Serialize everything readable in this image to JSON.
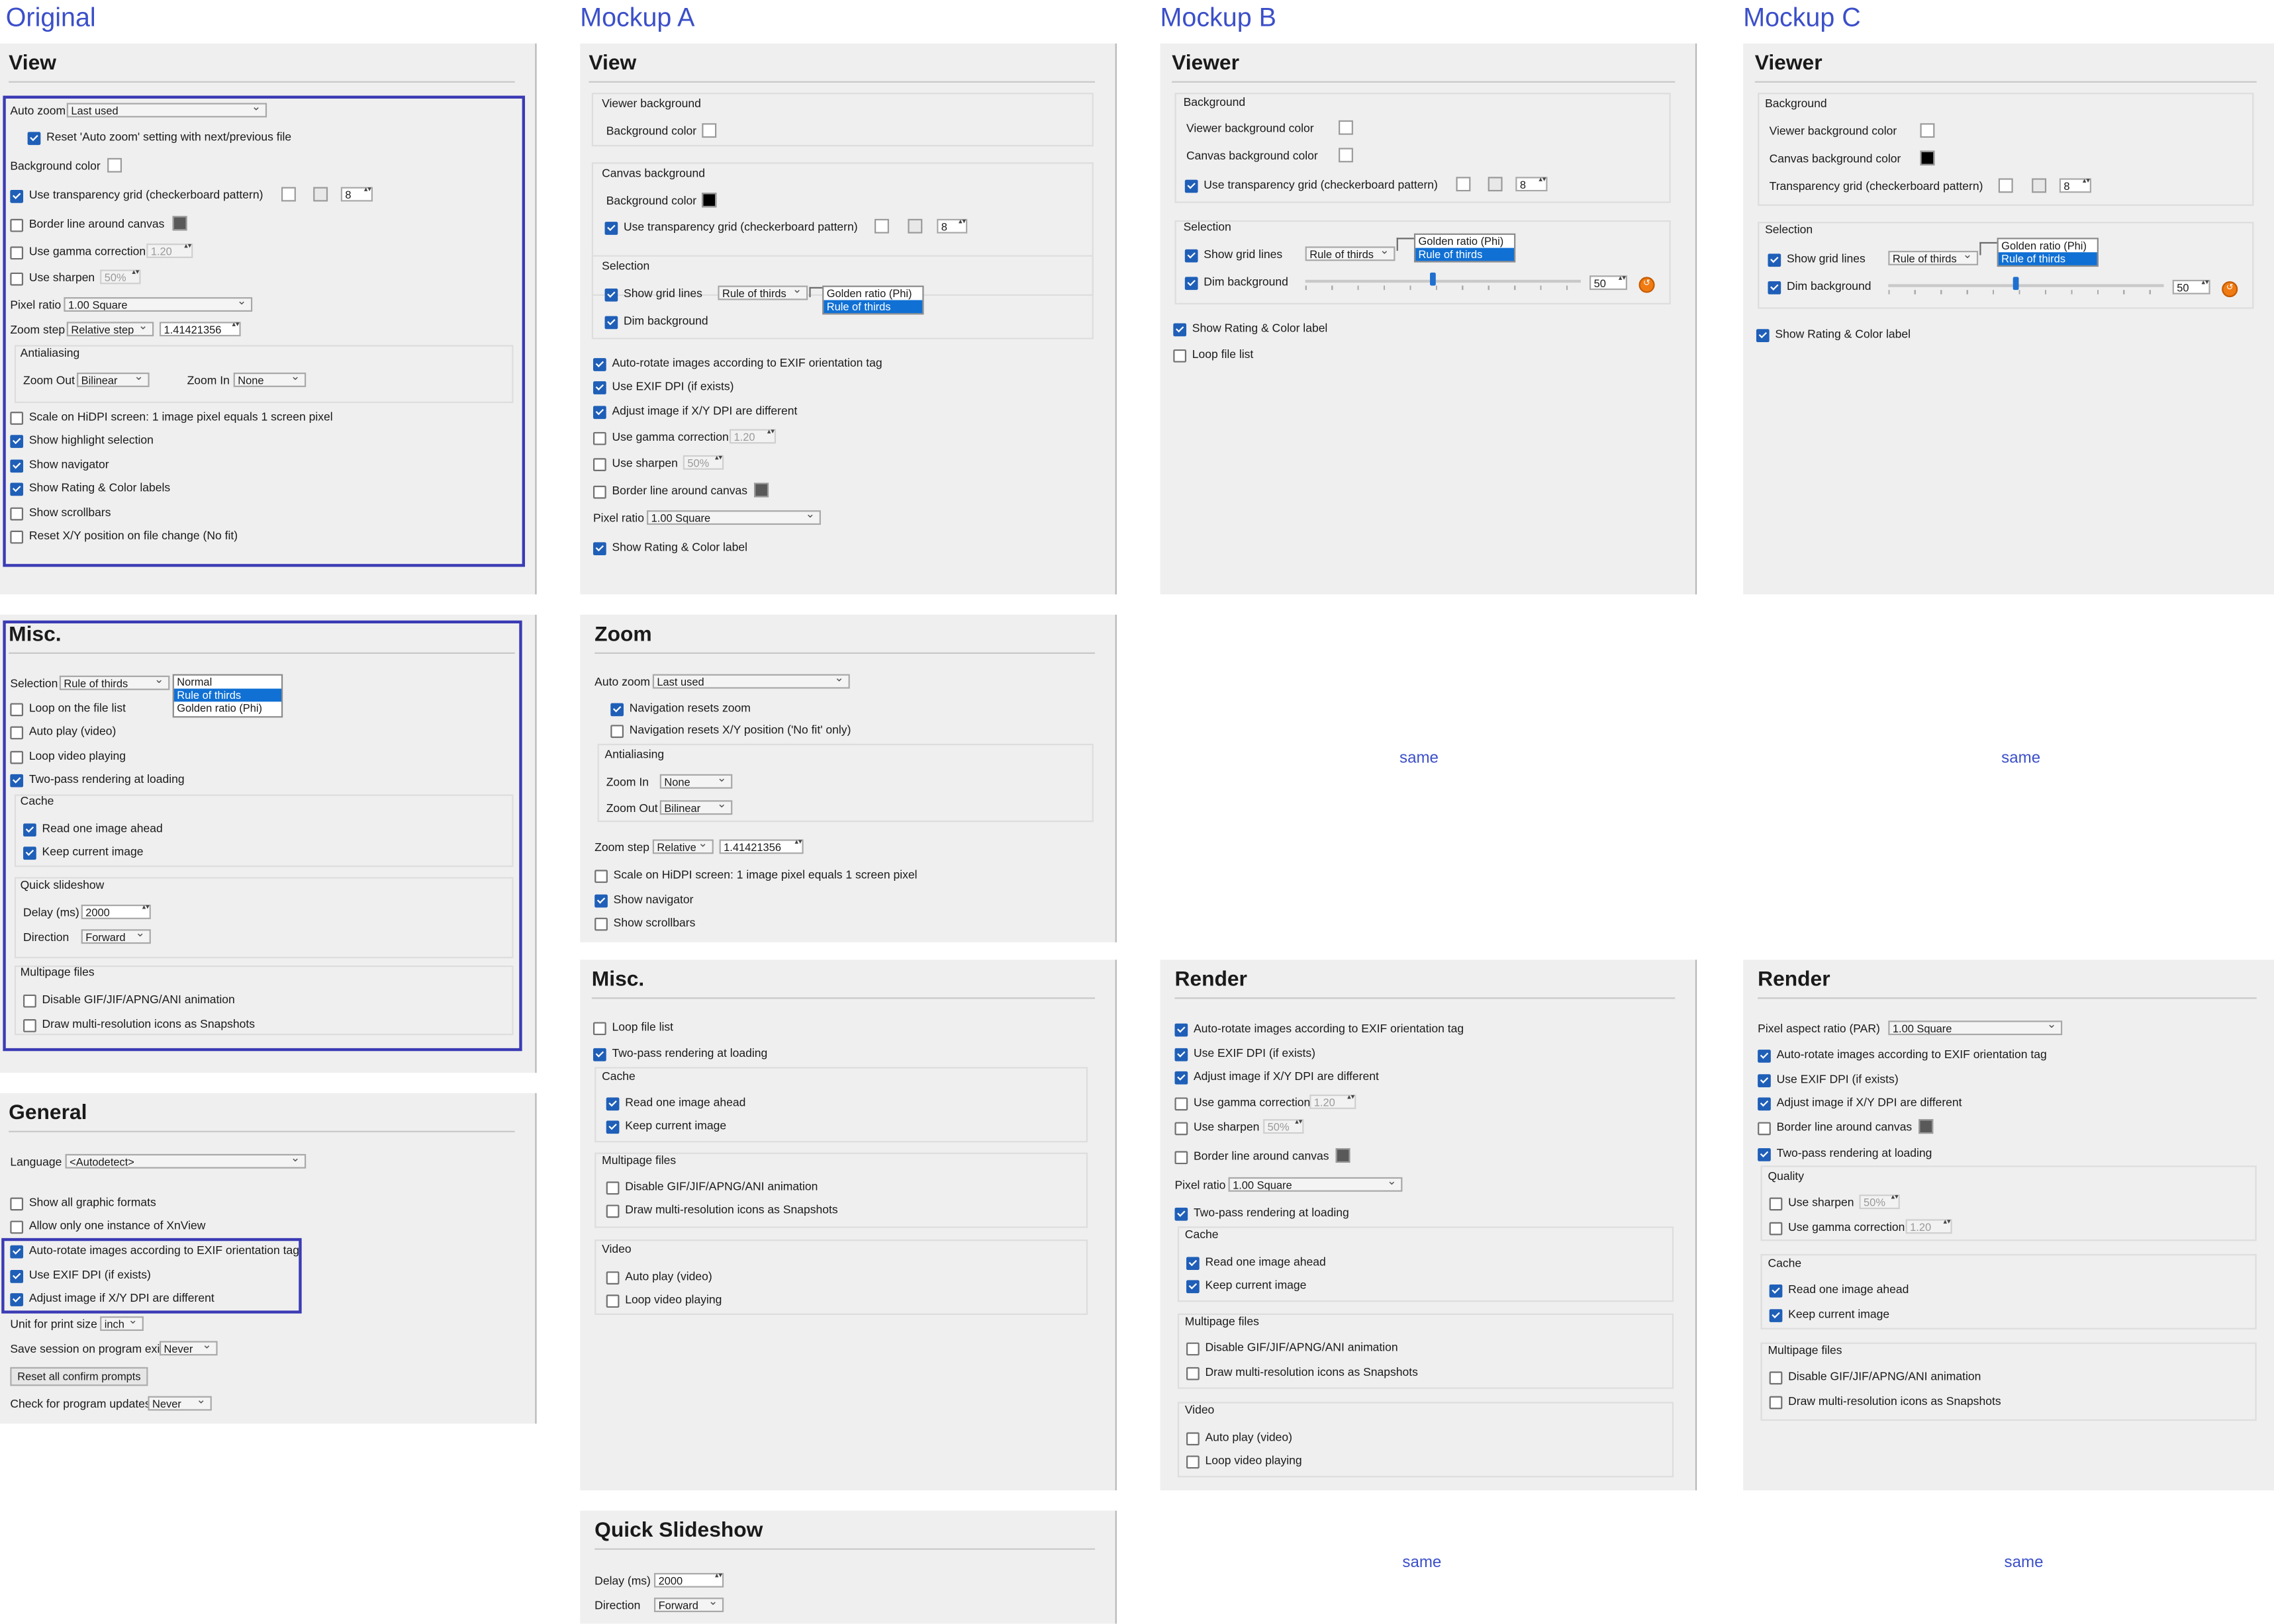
{
  "headers": {
    "original": "Original",
    "a": "Mockup A",
    "b": "Mockup B",
    "c": "Mockup C"
  },
  "same_text": "same",
  "orig_view": {
    "title": "View",
    "auto_zoom_label": "Auto zoom",
    "auto_zoom_value": "Last used",
    "reset_auto_zoom": "Reset 'Auto zoom' setting with next/previous file",
    "bg_color": "Background color",
    "transparency": "Use transparency grid (checkerboard pattern)",
    "grid_size": "8",
    "border_line": "Border line around canvas",
    "gamma": "Use gamma correction",
    "gamma_value": "1.20",
    "sharpen": "Use sharpen",
    "sharpen_value": "50%",
    "pixel_ratio_label": "Pixel ratio",
    "pixel_ratio_value": "1.00  Square",
    "zoom_step_label": "Zoom step",
    "zoom_step_mode": "Relative step",
    "zoom_step_value": "1.41421356",
    "antialiasing": "Antialiasing",
    "zoom_out_label": "Zoom Out",
    "zoom_out_value": "Bilinear",
    "zoom_in_label": "Zoom In",
    "zoom_in_value": "None",
    "hidpi": "Scale on HiDPI screen: 1 image pixel equals 1 screen pixel",
    "highlight": "Show highlight selection",
    "navigator": "Show navigator",
    "rating": "Show Rating & Color labels",
    "scrollbars": "Show scrollbars",
    "reset_xy": "Reset X/Y position on file change (No fit)"
  },
  "orig_misc": {
    "title": "Misc.",
    "selection_label": "Selection",
    "selection_value": "Rule of thirds",
    "selection_options": [
      "Normal",
      "Rule of thirds",
      "Golden ratio (Phi)"
    ],
    "loop": "Loop on the file list",
    "auto_play": "Auto play (video)",
    "loop_video": "Loop video playing",
    "two_pass": "Two-pass rendering at loading",
    "cache": "Cache",
    "read_ahead": "Read one image ahead",
    "keep_current": "Keep current image",
    "quick_slideshow": "Quick slideshow",
    "delay_label": "Delay (ms)",
    "delay_value": "2000",
    "direction_label": "Direction",
    "direction_value": "Forward",
    "multipage": "Multipage files",
    "disable_gif": "Disable GIF/JIF/APNG/ANI animation",
    "draw_multi": "Draw multi-resolution icons as Snapshots"
  },
  "orig_general": {
    "title": "General",
    "language_label": "Language",
    "language_value": "<Autodetect>",
    "show_all_formats": "Show all graphic formats",
    "one_instance": "Allow only one instance of XnView",
    "auto_rotate": "Auto-rotate images according to EXIF orientation tag",
    "exif_dpi": "Use EXIF DPI (if exists)",
    "adjust_dpi": "Adjust image if X/Y DPI are different",
    "unit_label": "Unit for print size",
    "unit_value": "inch",
    "save_session_label": "Save session on program exit",
    "save_session_value": "Never",
    "reset_prompts": "Reset all confirm prompts",
    "check_updates_label": "Check for program updates",
    "check_updates_value": "Never"
  },
  "a_view": {
    "title": "View",
    "viewer_bg": "Viewer background",
    "bg_color": "Background color",
    "canvas_bg": "Canvas background",
    "canvas_bg_color": "Background color",
    "transparency": "Use transparency grid (checkerboard pattern)",
    "grid_size": "8",
    "selection": "Selection",
    "grid_lines": "Show grid lines",
    "grid_value": "Rule of thirds",
    "grid_options": [
      "Golden ratio (Phi)",
      "Rule of thirds"
    ],
    "dim": "Dim background",
    "auto_rotate": "Auto-rotate images according to EXIF orientation tag",
    "exif_dpi": "Use EXIF DPI (if exists)",
    "adjust_dpi": "Adjust image if X/Y DPI are different",
    "gamma": "Use gamma correction",
    "gamma_value": "1.20",
    "sharpen": "Use sharpen",
    "sharpen_value": "50%",
    "border_line": "Border line around canvas",
    "pixel_ratio_label": "Pixel ratio",
    "pixel_ratio_value": "1.00  Square",
    "rating": "Show Rating & Color label"
  },
  "a_zoom": {
    "title": "Zoom",
    "auto_zoom_label": "Auto zoom",
    "auto_zoom_value": "Last used",
    "nav_resets": "Navigation resets zoom",
    "nav_resets_xy": "Navigation resets X/Y position ('No fit' only)",
    "antialiasing": "Antialiasing",
    "zoom_in_label": "Zoom In",
    "zoom_in_value": "None",
    "zoom_out_label": "Zoom Out",
    "zoom_out_value": "Bilinear",
    "zoom_step_label": "Zoom step",
    "zoom_step_mode": "Relative",
    "zoom_step_value": "1.41421356",
    "hidpi": "Scale on HiDPI screen: 1 image pixel equals 1 screen pixel",
    "navigator": "Show navigator",
    "scrollbars": "Show scrollbars"
  },
  "a_misc": {
    "title": "Misc.",
    "loop": "Loop file list",
    "two_pass": "Two-pass rendering at loading",
    "cache": "Cache",
    "read_ahead": "Read one image ahead",
    "keep_current": "Keep current image",
    "multipage": "Multipage files",
    "disable_gif": "Disable GIF/JIF/APNG/ANI animation",
    "draw_multi": "Draw multi-resolution icons as Snapshots",
    "video": "Video",
    "auto_play": "Auto play (video)",
    "loop_video": "Loop video playing"
  },
  "a_slideshow": {
    "title": "Quick Slideshow",
    "delay_label": "Delay (ms)",
    "delay_value": "2000",
    "direction_label": "Direction",
    "direction_value": "Forward"
  },
  "b_viewer": {
    "title": "Viewer",
    "background": "Background",
    "viewer_bg": "Viewer background color",
    "canvas_bg": "Canvas background color",
    "transparency": "Use transparency grid (checkerboard pattern)",
    "grid_size": "8",
    "selection": "Selection",
    "grid_lines": "Show grid lines",
    "grid_value": "Rule of thirds",
    "grid_options": [
      "Golden ratio (Phi)",
      "Rule of thirds"
    ],
    "dim": "Dim background",
    "dim_value": "50",
    "dim_level": 0.45,
    "rating": "Show Rating & Color label",
    "loop": "Loop  file list"
  },
  "b_render": {
    "title": "Render",
    "auto_rotate": "Auto-rotate images according to EXIF orientation tag",
    "exif_dpi": "Use EXIF DPI (if exists)",
    "adjust_dpi": "Adjust image if X/Y DPI are different",
    "gamma": "Use gamma correction",
    "gamma_value": "1.20",
    "sharpen": "Use sharpen",
    "sharpen_value": "50%",
    "border_line": "Border line around canvas",
    "pixel_ratio_label": "Pixel ratio",
    "pixel_ratio_value": "1.00  Square",
    "two_pass": "Two-pass rendering at loading",
    "cache": "Cache",
    "read_ahead": "Read one image ahead",
    "keep_current": "Keep current image",
    "multipage": "Multipage files",
    "disable_gif": "Disable GIF/JIF/APNG/ANI animation",
    "draw_multi": "Draw multi-resolution icons as Snapshots",
    "video": "Video",
    "auto_play": "Auto play (video)",
    "loop_video": "Loop video playing"
  },
  "c_viewer": {
    "title": "Viewer",
    "background": "Background",
    "viewer_bg": "Viewer background color",
    "canvas_bg": "Canvas background color",
    "transparency": "Transparency grid (checkerboard pattern)",
    "grid_size": "8",
    "selection": "Selection",
    "grid_lines": "Show grid lines",
    "grid_value": "Rule of thirds",
    "grid_options": [
      "Golden ratio (Phi)",
      "Rule of thirds"
    ],
    "dim": "Dim background",
    "dim_value": "50",
    "dim_level": 0.45,
    "rating": "Show Rating & Color label"
  },
  "c_render": {
    "title": "Render",
    "par_label": "Pixel aspect ratio (PAR)",
    "par_value": "1.00  Square",
    "auto_rotate": "Auto-rotate images according to EXIF orientation tag",
    "exif_dpi": "Use EXIF DPI (if exists)",
    "adjust_dpi": "Adjust image if X/Y DPI are different",
    "border_line": "Border line around canvas",
    "two_pass": "Two-pass rendering at loading",
    "quality": "Quality",
    "sharpen": "Use sharpen",
    "sharpen_value": "50%",
    "gamma": "Use gamma correction",
    "gamma_value": "1.20",
    "cache": "Cache",
    "read_ahead": "Read one image ahead",
    "keep_current": "Keep current image",
    "multipage": "Multipage files",
    "disable_gif": "Disable GIF/JIF/APNG/ANI animation",
    "draw_multi": "Draw multi-resolution icons as Snapshots"
  }
}
